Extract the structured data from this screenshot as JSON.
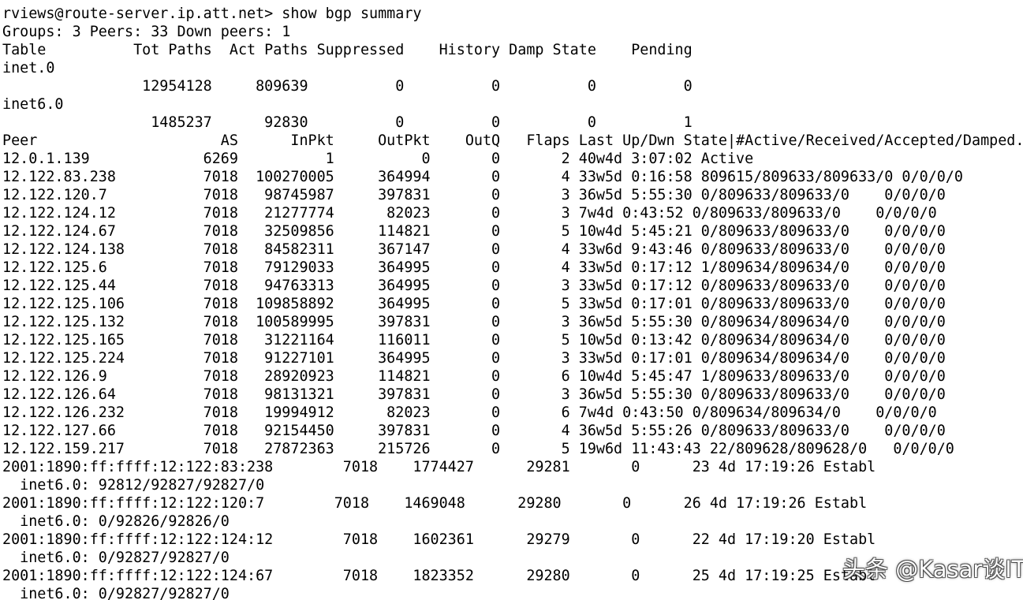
{
  "terminal": {
    "prompt": "rviews@route-server.ip.att.net> show bgp summary",
    "groups_line": "Groups: 3 Peers: 33 Down peers: 1",
    "table_header": "Table          Tot Paths  Act Paths Suppressed    History Damp State    Pending",
    "tables": [
      {
        "name": "inet.0",
        "stats": "                12954128     809639          0          0          0          0"
      },
      {
        "name": "inet6.0",
        "stats": "                 1485237      92830          0          0          0          1"
      }
    ],
    "peer_header": "Peer                     AS      InPkt     OutPkt    OutQ   Flaps Last Up/Dwn State|#Active/Received/Accepted/Damped...",
    "peer_rows": [
      "12.0.1.139             6269          1          0       0       2 40w4d 3:07:02 Active",
      "12.122.83.238          7018  100270005     364994       0       4 33w5d 0:16:58 809615/809633/809633/0 0/0/0/0",
      "12.122.120.7           7018   98745987     397831       0       3 36w5d 5:55:30 0/809633/809633/0    0/0/0/0",
      "12.122.124.12          7018   21277774      82023       0       3 7w4d 0:43:52 0/809633/809633/0    0/0/0/0",
      "12.122.124.67          7018   32509856     114821       0       5 10w4d 5:45:21 0/809633/809633/0    0/0/0/0",
      "12.122.124.138         7018   84582311     367147       0       4 33w6d 9:43:46 0/809633/809633/0    0/0/0/0",
      "12.122.125.6           7018   79129033     364995       0       4 33w5d 0:17:12 1/809634/809634/0    0/0/0/0",
      "12.122.125.44          7018   94763313     364995       0       3 33w5d 0:17:12 0/809633/809633/0    0/0/0/0",
      "12.122.125.106         7018  109858892     364995       0       5 33w5d 0:17:01 0/809633/809633/0    0/0/0/0",
      "12.122.125.132         7018  100589995     397831       0       3 36w5d 5:55:30 0/809634/809634/0    0/0/0/0",
      "12.122.125.165         7018   31221164     116011       0       5 10w5d 0:13:42 0/809634/809634/0    0/0/0/0",
      "12.122.125.224         7018   91227101     364995       0       3 33w5d 0:17:01 0/809634/809634/0    0/0/0/0",
      "12.122.126.9           7018   28920923     114821       0       6 10w4d 5:45:47 1/809633/809633/0    0/0/0/0",
      "12.122.126.64          7018   98131321     397831       0       3 36w5d 5:55:30 0/809633/809633/0    0/0/0/0",
      "12.122.126.232         7018   19994912      82023       0       6 7w4d 0:43:50 0/809634/809634/0    0/0/0/0",
      "12.122.127.66          7018   92154450     397831       0       4 36w5d 5:55:26 0/809633/809633/0    0/0/0/0",
      "12.122.159.217         7018   27872363     215726       0       5 19w6d 11:43:43 22/809628/809628/0   0/0/0/0"
    ],
    "v6_peers": [
      {
        "line": "2001:1890:ff:ffff:12:122:83:238        7018    1774427      29281       0      23 4d 17:19:26 Establ",
        "detail": "  inet6.0: 92812/92827/92827/0"
      },
      {
        "line": "2001:1890:ff:ffff:12:122:120:7        7018    1469048      29280       0      26 4d 17:19:26 Establ",
        "detail": "  inet6.0: 0/92826/92826/0"
      },
      {
        "line": "2001:1890:ff:ffff:12:122:124:12        7018    1602361      29279       0      22 4d 17:19:20 Establ",
        "detail": "  inet6.0: 0/92827/92827/0"
      },
      {
        "line": "2001:1890:ff:ffff:12:122:124:67        7018    1823352      29280       0      25 4d 17:19:25 Establ",
        "detail": "  inet6.0: 0/92827/92827/0"
      }
    ]
  },
  "watermark": {
    "text": "头条 @Kasar谈IT"
  }
}
